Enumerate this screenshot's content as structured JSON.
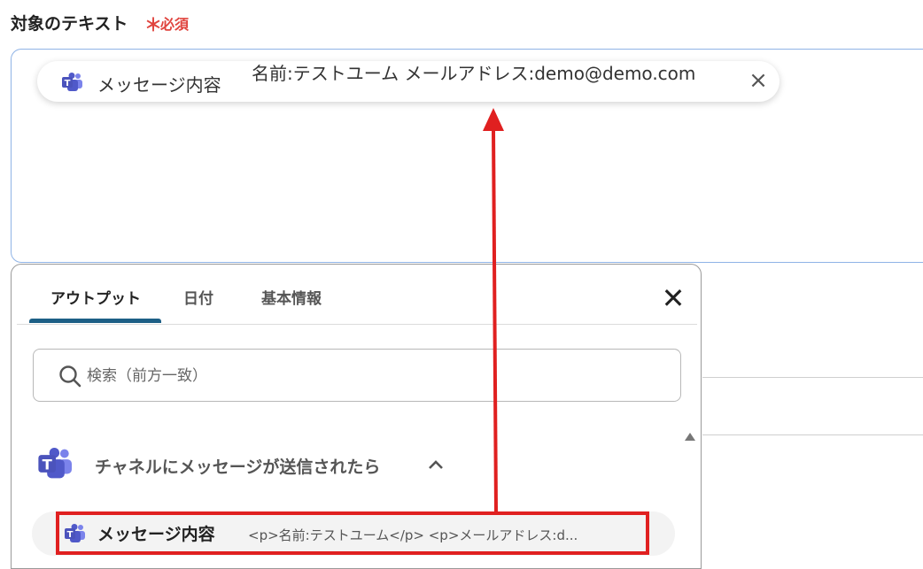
{
  "field": {
    "label": "対象のテキスト",
    "required_mark": "＊",
    "required_text": "必須"
  },
  "chip": {
    "icon": "teams-icon",
    "label": "メッセージ内容",
    "value": "名前:テストユーム  メールアドレス:demo@demo.com",
    "close": "×"
  },
  "panel": {
    "tabs": [
      {
        "label": "アウトプット",
        "active": true
      },
      {
        "label": "日付",
        "active": false
      },
      {
        "label": "基本情報",
        "active": false
      }
    ],
    "close": "✕",
    "search_placeholder": "検索（前方一致）",
    "group": {
      "title": "チャネルにメッセージが送信されたら",
      "icon": "teams-icon",
      "chevron": "^"
    },
    "item": {
      "icon": "teams-icon",
      "label": "メッセージ内容",
      "preview": "<p>名前:テストユーム</p> <p>メールアドレス:d..."
    }
  },
  "colors": {
    "accent": "#1d5f86",
    "required": "#e0443e",
    "annotation": "#e02020",
    "teams": "#5059c9"
  }
}
